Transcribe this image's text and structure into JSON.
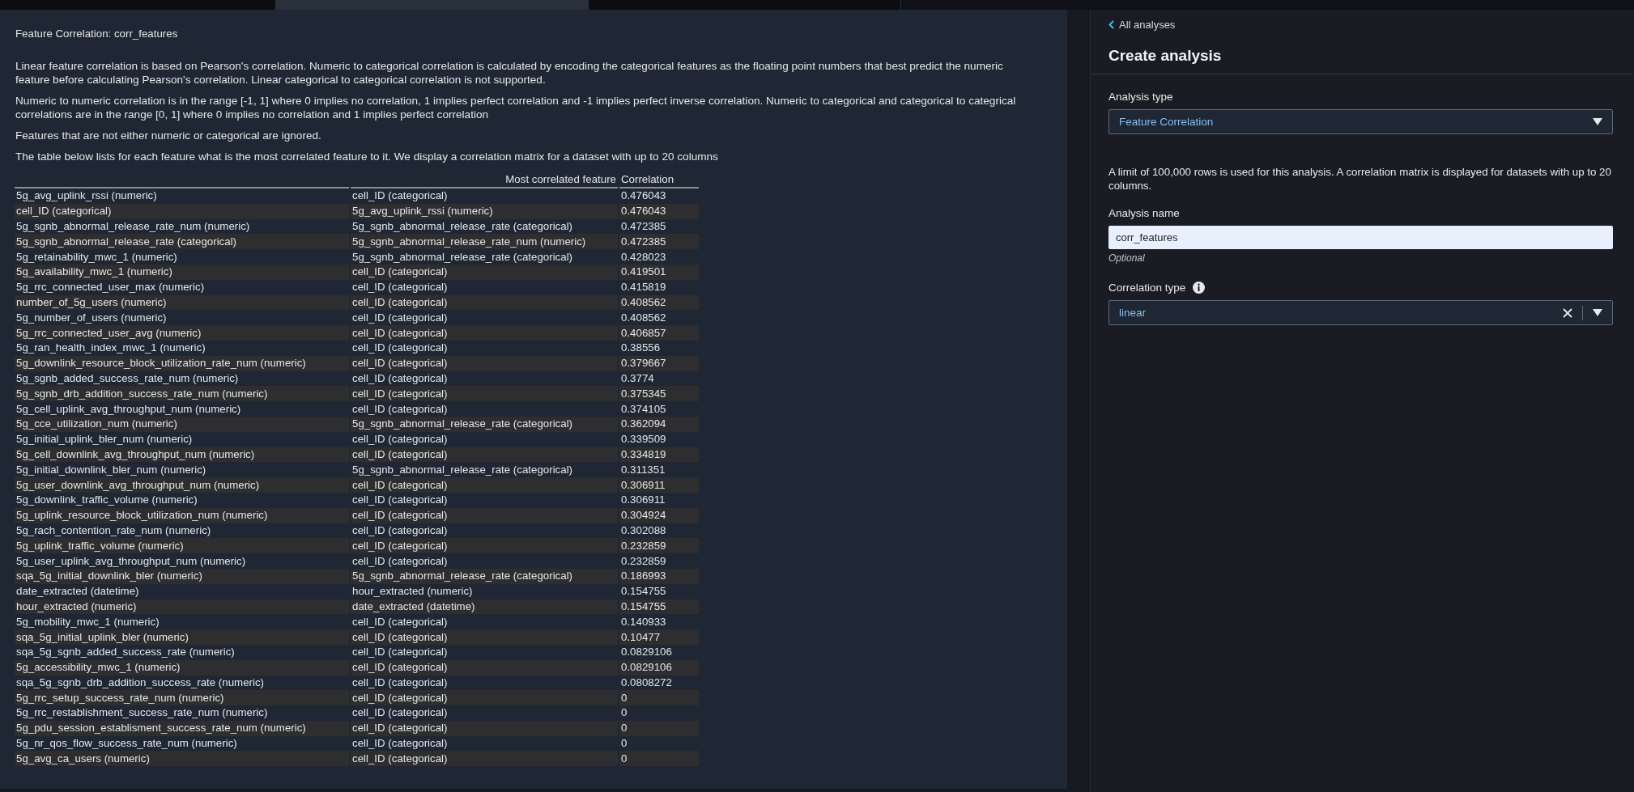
{
  "tabs": [
    {
      "selected": false
    },
    {
      "selected": true
    },
    {
      "selected": false
    }
  ],
  "report": {
    "title": "Feature Correlation: corr_features",
    "paragraphs": [
      "Linear feature correlation is based on Pearson's correlation. Numeric to categorical correlation is calculated by encoding the categorical features as the floating point numbers that best predict the numeric feature before calculating Pearson's correlation. Linear categorical to categorical correlation is not supported.",
      "Numeric to numeric correlation is in the range [-1, 1] where 0 implies no correlation, 1 implies perfect correlation and -1 implies perfect inverse correlation. Numeric to categorical and categorical to categrical correlations are in the range [0, 1] where 0 implies no correlation and 1 implies perfect correlation",
      "Features that are not either numeric or categorical are ignored.",
      "The table below lists for each feature what is the most correlated feature to it. We display a correlation matrix for a dataset with up to 20 columns"
    ],
    "table": {
      "columns": [
        "Most correlated feature",
        "Correlation"
      ],
      "rows": [
        {
          "feature": "5g_avg_uplink_rssi (numeric)",
          "most_correlated": "cell_ID (categorical)",
          "correlation": "0.476043"
        },
        {
          "feature": "cell_ID (categorical)",
          "most_correlated": "5g_avg_uplink_rssi (numeric)",
          "correlation": "0.476043"
        },
        {
          "feature": "5g_sgnb_abnormal_release_rate_num (numeric)",
          "most_correlated": "5g_sgnb_abnormal_release_rate (categorical)",
          "correlation": "0.472385"
        },
        {
          "feature": "5g_sgnb_abnormal_release_rate (categorical)",
          "most_correlated": "5g_sgnb_abnormal_release_rate_num (numeric)",
          "correlation": "0.472385"
        },
        {
          "feature": "5g_retainability_mwc_1 (numeric)",
          "most_correlated": "5g_sgnb_abnormal_release_rate (categorical)",
          "correlation": "0.428023"
        },
        {
          "feature": "5g_availability_mwc_1 (numeric)",
          "most_correlated": "cell_ID (categorical)",
          "correlation": "0.419501"
        },
        {
          "feature": "5g_rrc_connected_user_max (numeric)",
          "most_correlated": "cell_ID (categorical)",
          "correlation": "0.415819"
        },
        {
          "feature": "number_of_5g_users (numeric)",
          "most_correlated": "cell_ID (categorical)",
          "correlation": "0.408562"
        },
        {
          "feature": "5g_number_of_users (numeric)",
          "most_correlated": "cell_ID (categorical)",
          "correlation": "0.408562"
        },
        {
          "feature": "5g_rrc_connected_user_avg (numeric)",
          "most_correlated": "cell_ID (categorical)",
          "correlation": "0.406857"
        },
        {
          "feature": "5g_ran_health_index_mwc_1 (numeric)",
          "most_correlated": "cell_ID (categorical)",
          "correlation": "0.38556"
        },
        {
          "feature": "5g_downlink_resource_block_utilization_rate_num (numeric)",
          "most_correlated": "cell_ID (categorical)",
          "correlation": "0.379667"
        },
        {
          "feature": "5g_sgnb_added_success_rate_num (numeric)",
          "most_correlated": "cell_ID (categorical)",
          "correlation": "0.3774"
        },
        {
          "feature": "5g_sgnb_drb_addition_success_rate_num (numeric)",
          "most_correlated": "cell_ID (categorical)",
          "correlation": "0.375345"
        },
        {
          "feature": "5g_cell_uplink_avg_throughput_num (numeric)",
          "most_correlated": "cell_ID (categorical)",
          "correlation": "0.374105"
        },
        {
          "feature": "5g_cce_utilization_num (numeric)",
          "most_correlated": "5g_sgnb_abnormal_release_rate (categorical)",
          "correlation": "0.362094"
        },
        {
          "feature": "5g_initial_uplink_bler_num (numeric)",
          "most_correlated": "cell_ID (categorical)",
          "correlation": "0.339509"
        },
        {
          "feature": "5g_cell_downlink_avg_throughput_num (numeric)",
          "most_correlated": "cell_ID (categorical)",
          "correlation": "0.334819"
        },
        {
          "feature": "5g_initial_downlink_bler_num (numeric)",
          "most_correlated": "5g_sgnb_abnormal_release_rate (categorical)",
          "correlation": "0.311351"
        },
        {
          "feature": "5g_user_downlink_avg_throughput_num (numeric)",
          "most_correlated": "cell_ID (categorical)",
          "correlation": "0.306911"
        },
        {
          "feature": "5g_downlink_traffic_volume (numeric)",
          "most_correlated": "cell_ID (categorical)",
          "correlation": "0.306911"
        },
        {
          "feature": "5g_uplink_resource_block_utilization_num (numeric)",
          "most_correlated": "cell_ID (categorical)",
          "correlation": "0.304924"
        },
        {
          "feature": "5g_rach_contention_rate_num (numeric)",
          "most_correlated": "cell_ID (categorical)",
          "correlation": "0.302088"
        },
        {
          "feature": "5g_uplink_traffic_volume (numeric)",
          "most_correlated": "cell_ID (categorical)",
          "correlation": "0.232859"
        },
        {
          "feature": "5g_user_uplink_avg_throughput_num (numeric)",
          "most_correlated": "cell_ID (categorical)",
          "correlation": "0.232859"
        },
        {
          "feature": "sqa_5g_initial_downlink_bler (numeric)",
          "most_correlated": "5g_sgnb_abnormal_release_rate (categorical)",
          "correlation": "0.186993"
        },
        {
          "feature": "date_extracted (datetime)",
          "most_correlated": "hour_extracted (numeric)",
          "correlation": "0.154755"
        },
        {
          "feature": "hour_extracted (numeric)",
          "most_correlated": "date_extracted (datetime)",
          "correlation": "0.154755"
        },
        {
          "feature": "5g_mobility_mwc_1 (numeric)",
          "most_correlated": "cell_ID (categorical)",
          "correlation": "0.140933"
        },
        {
          "feature": "sqa_5g_initial_uplink_bler (numeric)",
          "most_correlated": "cell_ID (categorical)",
          "correlation": "0.10477"
        },
        {
          "feature": "sqa_5g_sgnb_added_success_rate (numeric)",
          "most_correlated": "cell_ID (categorical)",
          "correlation": "0.0829106"
        },
        {
          "feature": "5g_accessibility_mwc_1 (numeric)",
          "most_correlated": "cell_ID (categorical)",
          "correlation": "0.0829106"
        },
        {
          "feature": "sqa_5g_sgnb_drb_addition_success_rate (numeric)",
          "most_correlated": "cell_ID (categorical)",
          "correlation": "0.0808272"
        },
        {
          "feature": "5g_rrc_setup_success_rate_num (numeric)",
          "most_correlated": "cell_ID (categorical)",
          "correlation": "0"
        },
        {
          "feature": "5g_rrc_restablishment_success_rate_num (numeric)",
          "most_correlated": "cell_ID (categorical)",
          "correlation": "0"
        },
        {
          "feature": "5g_pdu_session_establisment_success_rate_num (numeric)",
          "most_correlated": "cell_ID (categorical)",
          "correlation": "0"
        },
        {
          "feature": "5g_nr_qos_flow_success_rate_num (numeric)",
          "most_correlated": "cell_ID (categorical)",
          "correlation": "0"
        },
        {
          "feature": "5g_avg_ca_users (numeric)",
          "most_correlated": "cell_ID (categorical)",
          "correlation": "0"
        }
      ]
    }
  },
  "side_panel": {
    "back_link": "All analyses",
    "title": "Create analysis",
    "analysis_type": {
      "label": "Analysis type",
      "value": "Feature Correlation"
    },
    "info": "A limit of 100,000 rows is used for this analysis. A correlation matrix is displayed for datasets with up to 20 columns.",
    "analysis_name": {
      "label": "Analysis name",
      "value": "corr_features",
      "hint": "Optional"
    },
    "correlation_type": {
      "label": "Correlation type",
      "value": "linear"
    }
  }
}
